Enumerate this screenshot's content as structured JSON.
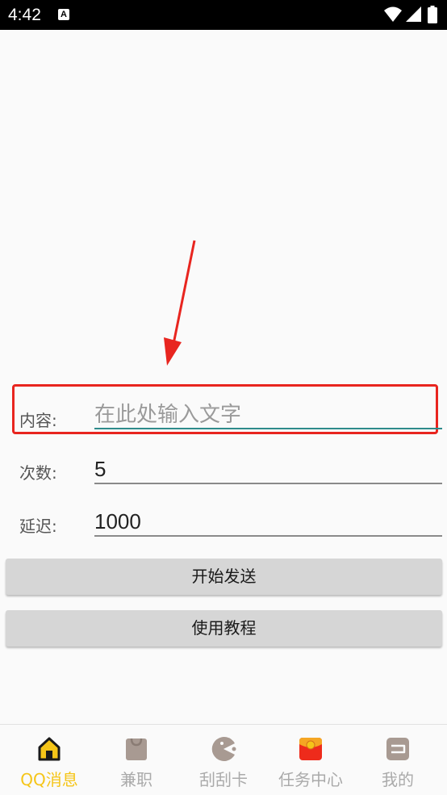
{
  "status_bar": {
    "time": "4:42",
    "notification_glyph": "A"
  },
  "form": {
    "content_label": "内容:",
    "content_placeholder": "在此处输入文字",
    "content_value": "",
    "count_label": "次数:",
    "count_value": "5",
    "delay_label": "延迟:",
    "delay_value": "1000"
  },
  "buttons": {
    "start": "开始发送",
    "tutorial": "使用教程"
  },
  "tabbar": {
    "items": [
      {
        "label": "QQ消息",
        "icon": "home-icon",
        "active": true
      },
      {
        "label": "兼职",
        "icon": "bag-icon",
        "active": false
      },
      {
        "label": "刮刮卡",
        "icon": "pacman-icon",
        "active": false
      },
      {
        "label": "任务中心",
        "icon": "red-envelope-icon",
        "active": false
      },
      {
        "label": "我的",
        "icon": "profile-card-icon",
        "active": false
      }
    ]
  },
  "colors": {
    "accent_active_tab": "#f5c518",
    "highlight_box": "#e8251f",
    "arrow": "#e8251f"
  }
}
